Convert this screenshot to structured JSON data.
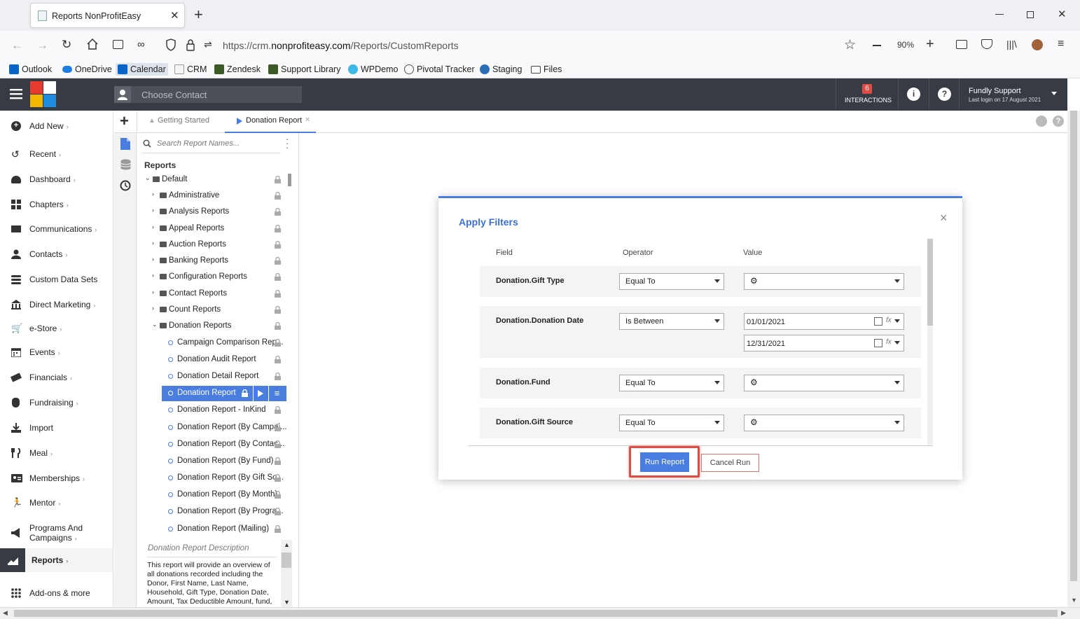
{
  "browser": {
    "tab_title": "Reports NonProfitEasy",
    "new_tab": "+",
    "url_prefix": "https://crm.",
    "url_domain": "nonprofiteasy.com",
    "url_path": "/Reports/CustomReports",
    "zoom": "90%",
    "bookmarks": [
      "Outlook",
      "OneDrive",
      "Calendar",
      "CRM",
      "Zendesk",
      "Support Library",
      "WPDemo",
      "Pivotal Tracker",
      "Staging",
      "Files"
    ]
  },
  "header": {
    "contact_placeholder": "Choose Contact",
    "interactions_count": "6",
    "interactions_label": "INTERACTIONS",
    "user_name": "Fundly Support",
    "last_login": "Last login on 17 August 2021"
  },
  "sidebar": {
    "items": [
      {
        "label": "Add New",
        "icon": "plus-circle-icon"
      },
      {
        "label": "Recent",
        "icon": "history-icon"
      },
      {
        "label": "Dashboard",
        "icon": "dashboard-icon"
      },
      {
        "label": "Chapters",
        "icon": "grid-icon"
      },
      {
        "label": "Communications",
        "icon": "envelope-icon"
      },
      {
        "label": "Contacts",
        "icon": "user-icon"
      },
      {
        "label": "Custom Data Sets",
        "icon": "database-icon"
      },
      {
        "label": "Direct Marketing",
        "icon": "bank-icon"
      },
      {
        "label": "e-Store",
        "icon": "cart-icon"
      },
      {
        "label": "Events",
        "icon": "calendar-icon"
      },
      {
        "label": "Financials",
        "icon": "money-icon"
      },
      {
        "label": "Fundraising",
        "icon": "moneybag-icon"
      },
      {
        "label": "Import",
        "icon": "import-icon"
      },
      {
        "label": "Meal",
        "icon": "cutlery-icon"
      },
      {
        "label": "Memberships",
        "icon": "id-card-icon"
      },
      {
        "label": "Mentor",
        "icon": "mentor-icon"
      },
      {
        "label": "Programs And",
        "label2": "Campaigns",
        "icon": "megaphone-icon"
      },
      {
        "label": "Reports",
        "icon": "chart-icon"
      },
      {
        "label": "Add-ons & more",
        "icon": "apps-icon"
      }
    ]
  },
  "tabs": {
    "getting_started": "Getting Started",
    "donation_report": "Donation Report"
  },
  "tree": {
    "search_placeholder": "Search Report Names...",
    "heading": "Reports",
    "root": "Default",
    "folders": [
      "Administrative",
      "Analysis Reports",
      "Appeal Reports",
      "Auction Reports",
      "Banking Reports",
      "Configuration Reports",
      "Contact Reports",
      "Count Reports",
      "Donation Reports"
    ],
    "reports": [
      "Campaign Comparison Rep...",
      "Donation Audit Report",
      "Donation Detail Report",
      "Donation Report",
      "Donation Report - InKind",
      "Donation Report (By Campai...",
      "Donation Report (By Contac...",
      "Donation Report (By Fund)",
      "Donation Report (By Gift So...",
      "Donation Report (By Month)",
      "Donation Report (By Progra...",
      "Donation Report (Mailing)"
    ],
    "description_title": "Donation Report Description",
    "description_text": "This report will provide an overview of all donations recorded including the Donor, First Name, Last Name, Household, Gift Type, Donation Date, Amount, Tax Deductible Amount, fund,"
  },
  "dialog": {
    "title": "Apply Filters",
    "col_field": "Field",
    "col_operator": "Operator",
    "col_value": "Value",
    "filters": [
      {
        "field": "Donation.Gift Type",
        "operator": "Equal To"
      },
      {
        "field": "Donation.Donation Date",
        "operator": "Is Between",
        "from": "01/01/2021",
        "to": "12/31/2021"
      },
      {
        "field": "Donation.Fund",
        "operator": "Equal To"
      },
      {
        "field": "Donation.Gift Source",
        "operator": "Equal To"
      }
    ],
    "run_label": "Run Report",
    "cancel_label": "Cancel Run",
    "close": "×",
    "fx": "fx"
  },
  "colors": {
    "accent": "#4a7de0",
    "header_bg": "#373b43",
    "highlight": "#e04c44",
    "badge": "#e04c44"
  }
}
